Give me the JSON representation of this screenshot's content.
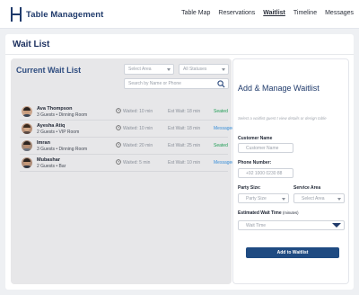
{
  "header": {
    "app_title": "Table Management",
    "nav": [
      {
        "label": "Table Map",
        "active": false
      },
      {
        "label": "Reservations",
        "active": false
      },
      {
        "label": "Waitlist",
        "active": true
      },
      {
        "label": "Timeline",
        "active": false
      },
      {
        "label": "Messages",
        "active": false
      }
    ]
  },
  "page": {
    "title": "Wait List"
  },
  "waitlist": {
    "title": "Current Wait List",
    "area_filter": "Select Area",
    "status_filter": "All Statuses",
    "search_placeholder": "Search by Name or Phone",
    "entries": [
      {
        "name": "Ava Thompson",
        "details": "3 Guests • Dinning Room",
        "waited": "Waited: 10 min",
        "est": "Est Wait: 18 min",
        "status": "Seated",
        "status_color": "#1f9d55"
      },
      {
        "name": "Ayesha Atiq",
        "details": "2 Guests • VIP Room",
        "waited": "Waited: 10 min",
        "est": "Est Wait: 18 min",
        "status": "Messaged",
        "status_color": "#3a8fd8"
      },
      {
        "name": "Imran",
        "details": "3 Guests • Dinning Room",
        "waited": "Waited: 20 min",
        "est": "Est Wait: 25 min",
        "status": "Seated",
        "status_color": "#1f9d55"
      },
      {
        "name": "Mubashar",
        "details": "2 Guests • Bar",
        "waited": "Waited: 5 min",
        "est": "Est Wait: 10 min",
        "status": "Messaged",
        "status_color": "#3a8fd8"
      }
    ]
  },
  "manage": {
    "title": "Add & Manage Waitlist",
    "hint": "Select a waitlist guest t view details or design table",
    "customer_name_label": "Customer Name",
    "customer_name_placeholder": "Customer Name",
    "phone_label": "Phone Number:",
    "phone_placeholder": "+92 1000 0230 88",
    "party_size_label": "Party Size:",
    "party_size_placeholder": "Party Size",
    "service_area_label": "Service Area",
    "service_area_placeholder": "Select Area",
    "wait_time_label": "Estimated Wait Time",
    "wait_time_unit": "(minutes)",
    "wait_time_placeholder": "Wait Time",
    "add_button": "Add to Waitlist"
  }
}
